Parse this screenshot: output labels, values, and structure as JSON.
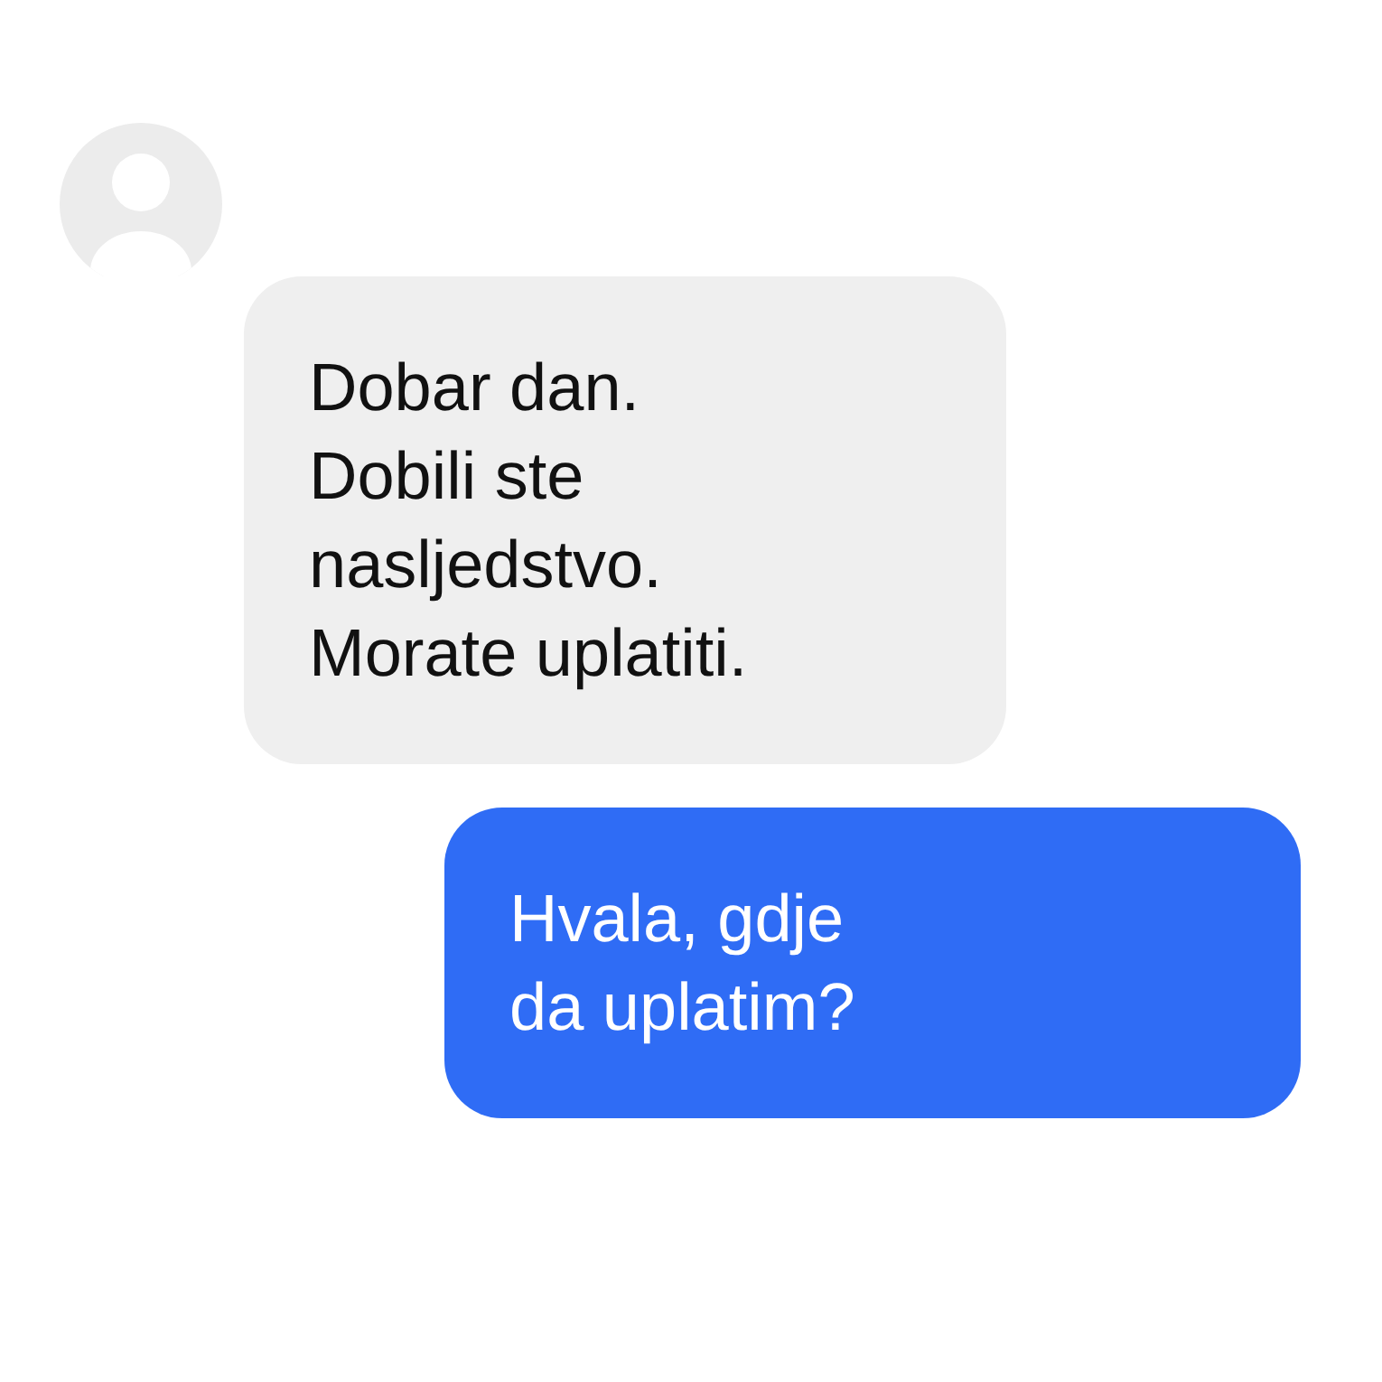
{
  "messages": [
    {
      "kind": "incoming",
      "text": "Dobar dan.\nDobili ste\nnasljedstvo.\nMorate uplatiti."
    },
    {
      "kind": "outgoing",
      "text": "Hvala, gdje\nda uplatim?"
    }
  ]
}
